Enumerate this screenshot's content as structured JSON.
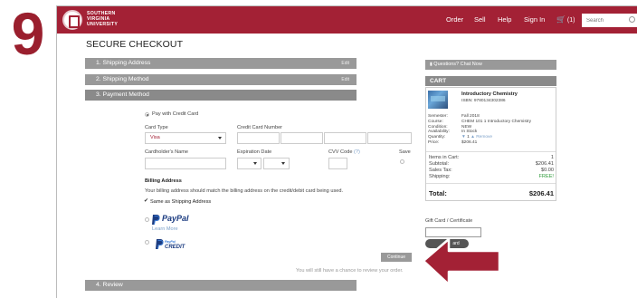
{
  "step_number": "9",
  "header": {
    "logo_line1": "SOUTHERN",
    "logo_line2": "VIRGINIA",
    "logo_line3": "UNIVERSITY",
    "nav": [
      "Order",
      "Sell",
      "Help",
      "Sign In"
    ],
    "cart_count": "(1)",
    "search_placeholder": "Search"
  },
  "checkout": {
    "title": "SECURE CHECKOUT",
    "steps": [
      {
        "label": "1. Shipping Address",
        "edit": "Edit"
      },
      {
        "label": "2. Shipping Method",
        "edit": "Edit"
      },
      {
        "label": "3. Payment Method"
      },
      {
        "label": "4. Review"
      }
    ]
  },
  "payment": {
    "pay_with_credit": "Pay with Credit Card",
    "card_type_label": "Card Type",
    "card_type_value": "Visa",
    "card_number_label": "Credit Card Number",
    "cardholder_label": "Cardholder's Name",
    "expiration_label": "Expiration Date",
    "cvv_label": "CVV Code",
    "cvv_help": "(?)",
    "save_label": "Save",
    "billing_title": "Billing Address",
    "billing_note": "Your billing address should match the billing address on the credit/debit card being used.",
    "same_as_shipping": "Same as Shipping Address",
    "paypal_label": "PayPal",
    "learn_more": "Learn More",
    "paypal_credit_top": "PayPal",
    "paypal_credit_bottom": "CREDIT",
    "continue_label": "Continue",
    "review_note": "You will still have a chance to review your order."
  },
  "sidebar": {
    "questions": "Questions? Chat Now",
    "cart_title": "CART",
    "book_title": "Introductory Chemistry",
    "isbn": "ISBN: 9780134302386",
    "details": [
      {
        "label": "Semester:",
        "value": "Fall 2018"
      },
      {
        "label": "Course:",
        "value": "CHEM 101 1 Introductory Chemistry"
      },
      {
        "label": "Condition:",
        "value": "NEW"
      },
      {
        "label": "Availability:",
        "value": "In Stock"
      },
      {
        "label": "Quantity:",
        "value": "1"
      },
      {
        "label": "Price:",
        "value": "$206.41"
      }
    ],
    "remove": "Remove",
    "items_label": "Items in Cart:",
    "items_value": "1",
    "subtotal_label": "Subtotal:",
    "subtotal_value": "$206.41",
    "tax_label": "Sales Tax:",
    "tax_value": "$0.00",
    "shipping_label": "Shipping:",
    "shipping_value": "FREE!",
    "total_label": "Total:",
    "total_value": "$206.41",
    "gift_label": "Gift Card / Certificate",
    "apply_label": "ard"
  },
  "colors": {
    "brand": "#a32135",
    "step_bg": "#999999",
    "free": "#2e9a3a",
    "arrow": "#a32135"
  }
}
